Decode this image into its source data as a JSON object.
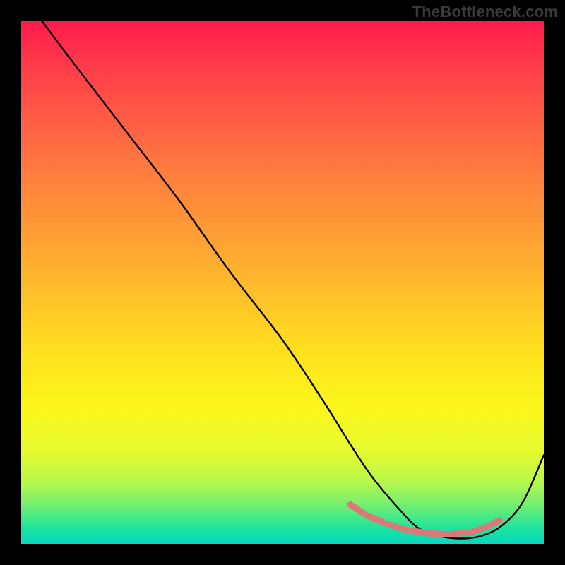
{
  "watermark": "TheBottleneck.com",
  "chart_data": {
    "type": "line",
    "title": "",
    "xlabel": "",
    "ylabel": "",
    "xlim": [
      0,
      100
    ],
    "ylim": [
      0,
      100
    ],
    "grid": false,
    "background": "red-yellow-green vertical gradient",
    "series": [
      {
        "name": "bottleneck-curve",
        "color": "#000000",
        "x": [
          4,
          10,
          20,
          30,
          40,
          50,
          58,
          63,
          67,
          72,
          76,
          80,
          84,
          88,
          92,
          96,
          100
        ],
        "y": [
          100,
          92,
          79,
          66,
          52,
          39,
          27,
          19,
          13,
          7,
          3,
          1.5,
          1,
          1.5,
          3.5,
          8,
          17
        ]
      }
    ],
    "markers": {
      "name": "recommended-range",
      "color": "#d97a78",
      "style": "dashed-beads",
      "points": [
        {
          "x": 63,
          "y": 7.5
        },
        {
          "x": 66,
          "y": 5.5
        },
        {
          "x": 70,
          "y": 3.8
        },
        {
          "x": 74,
          "y": 2.6
        },
        {
          "x": 78,
          "y": 2.0
        },
        {
          "x": 82,
          "y": 1.8
        },
        {
          "x": 86,
          "y": 2.2
        },
        {
          "x": 89,
          "y": 3.2
        },
        {
          "x": 91.5,
          "y": 4.5
        }
      ]
    }
  }
}
